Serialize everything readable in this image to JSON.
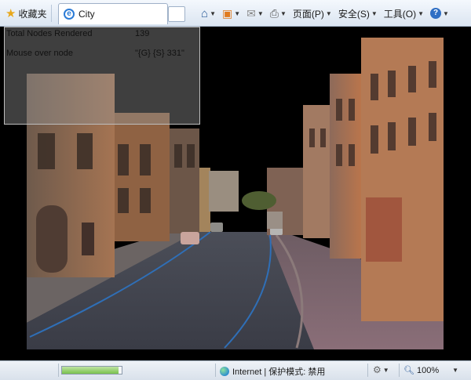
{
  "toolbar": {
    "favorites_label": "收藏夹",
    "tab_title": "City",
    "page_menu": "页面(P)",
    "safety_menu": "安全(S)",
    "tools_menu": "工具(O)"
  },
  "overlay": {
    "nodes_label": "Total Nodes Rendered",
    "nodes_value": "139",
    "mouse_label": "Mouse over node",
    "mouse_value": "\"{G} {S} 331\""
  },
  "status": {
    "progress_fraction": 0.95,
    "zone_text": "Internet | 保护模式: 禁用",
    "zoom_text": "100%"
  },
  "colors": {
    "toolbar_bg": "#dbe5f1",
    "scene_bg": "#000000",
    "road": "#3a3d48",
    "lane_line": "#2f6fb7"
  }
}
